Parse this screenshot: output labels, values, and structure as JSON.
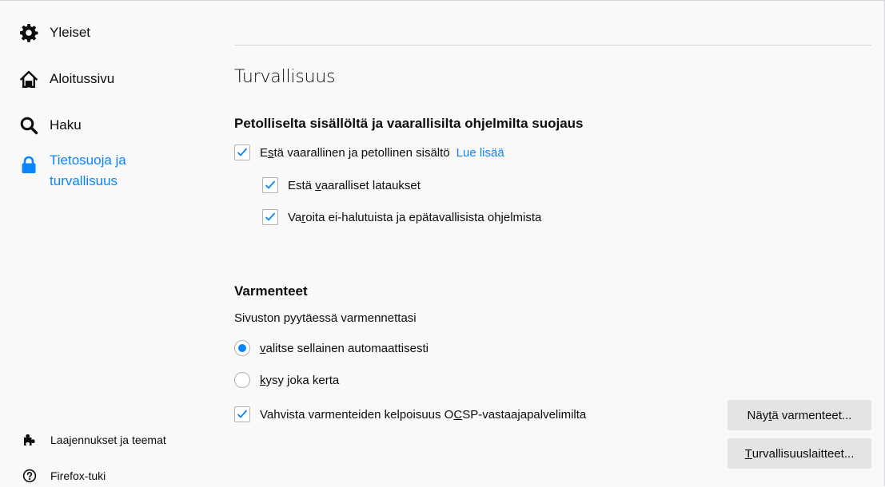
{
  "sidebar": {
    "items": [
      {
        "label": "Yleiset",
        "icon": "gear-icon"
      },
      {
        "label": "Aloitussivu",
        "icon": "home-icon"
      },
      {
        "label": "Haku",
        "icon": "search-icon"
      },
      {
        "label": "Tietosuoja ja turvallisuus",
        "icon": "lock-icon",
        "selected": true
      }
    ],
    "footer": [
      {
        "label": "Laajennukset ja teemat",
        "icon": "puzzle-icon"
      },
      {
        "label": "Firefox-tuki",
        "icon": "help-icon"
      }
    ]
  },
  "main": {
    "heading": "Turvallisuus",
    "deceptive": {
      "title": "Petolliselta sisällöltä ja vaarallisilta ohjelmilta suojaus",
      "block": {
        "pre": "E",
        "key": "s",
        "post": "tä vaarallinen ja petollinen sisältö",
        "checked": true
      },
      "learn_more": "Lue lisää",
      "downloads": {
        "pre": "Estä ",
        "key": "v",
        "post": "aaralliset lataukset",
        "checked": true
      },
      "unwanted": {
        "pre": "Va",
        "key": "r",
        "post": "oita ei-halutuista ja epätavallisista ohjelmista",
        "checked": true
      }
    },
    "certs": {
      "title": "Varmenteet",
      "prompt": "Sivuston pyytäessä varmennettasi",
      "auto": {
        "pre": "",
        "key": "v",
        "post": "alitse sellainen automaattisesti",
        "selected": true
      },
      "ask": {
        "pre": "",
        "key": "k",
        "post": "ysy joka kerta",
        "selected": false
      },
      "ocsp": {
        "pre": "Vahvista varmenteiden kelpoisuus O",
        "key": "C",
        "post": "SP-vastaajapalvelimilta",
        "checked": true
      },
      "view_button": {
        "pre": "Näy",
        "key": "t",
        "post": "ä varmenteet..."
      },
      "devices_button": {
        "pre": "",
        "key": "T",
        "post": "urvallisuuslaitteet..."
      }
    }
  },
  "colors": {
    "accent": "#0a84ff",
    "background": "#f9f9fa",
    "button": "#e4e4e6"
  }
}
